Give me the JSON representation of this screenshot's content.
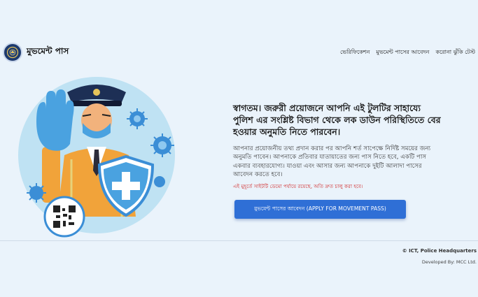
{
  "brand": {
    "title": "মুভমেন্ট পাস",
    "logo_icon": "police-emblem-icon"
  },
  "nav": {
    "items": [
      {
        "label": "ভেরিফিকেশন"
      },
      {
        "label": "মুভমেন্ট পাসের আবেদন"
      },
      {
        "label": "করোনা ঝুঁকি টেস্ট"
      }
    ]
  },
  "hero": {
    "headline": "স্বাগতম। জরুরী প্রয়োজনে আপনি এই টুলটির সাহায্যে পুলিশ এর সংশ্লিষ্ট বিভাগ থেকে লক ডাউন পরিস্থিতিতে বের হওয়ার অনুমতি নিতে পারবেন।",
    "description": "আপনার প্রয়োজনীয় তথ্য প্রদান করার পর আপনি শর্ত সাপেক্ষে নির্দিষ্ট সময়ের জন্য অনুমতি পাবেন। আপনাকে প্রতিবার যাতায়াতের জন্য পাস নিতে হবে, একটি পাস একবার ব্যবহারযোগ্য। যাওয়া এবং আসার জন্য আপনাকে দুইটি আলাদা পাসের আবেদন করতে হবে।",
    "notice": "এই মুহূর্তে সাইটটি ডেমো পর্যায়ে রয়েছে, অতি দ্রুত চালু করা হবে।",
    "apply_button": "মুভমেন্ট পাসের আবেদন (APPLY FOR MOVEMENT PASS)"
  },
  "footer": {
    "copyright": "© ICT, Police Headquarters",
    "developed_by": "Developed By: MCC Ltd."
  },
  "colors": {
    "background": "#eaf3fb",
    "primary_button": "#2f6fd6",
    "notice_text": "#d02525",
    "illustration_circle": "#bfe2f3",
    "virus": "#3b8ed6"
  },
  "illustration": {
    "icons": [
      "police-officer-icon",
      "stop-hand-icon",
      "virus-icon",
      "shield-cross-icon",
      "qr-code-icon"
    ]
  }
}
